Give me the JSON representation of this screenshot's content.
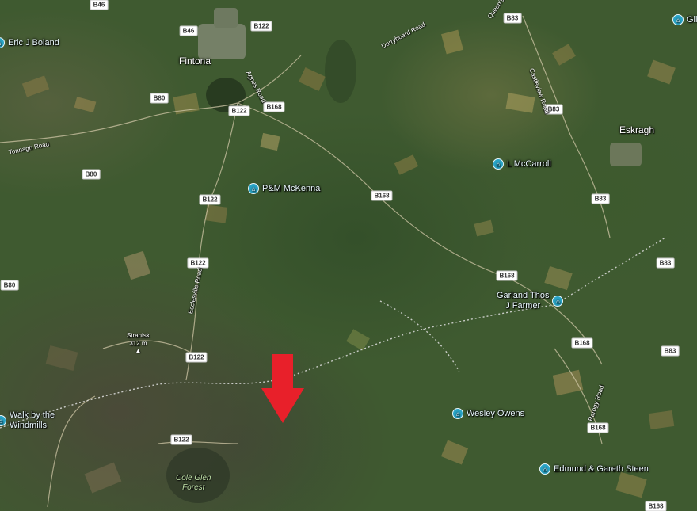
{
  "map": {
    "type": "satellite"
  },
  "road_labels": [
    "B46",
    "B46",
    "B122",
    "B83",
    "B80",
    "B122",
    "B168",
    "B83",
    "B80",
    "B168",
    "B122",
    "B122",
    "B168",
    "B80",
    "B83",
    "B83",
    "B122",
    "B168",
    "B83",
    "B122",
    "B168",
    "B168"
  ],
  "places": {
    "fintona": "Fintona",
    "eskragh": "Eskragh"
  },
  "street_names": {
    "ardsroad": "Agnes Road",
    "derryboard": "Derryboard Road",
    "tonnagh": "Tonnagh Road",
    "ecclesville": "Ecclesville Road",
    "road_right": "Castleview Road",
    "road_lower": "Rarogy Road",
    "road_top": "Queen's Road"
  },
  "pois": {
    "eric_j_boland": "Eric J Boland",
    "gil": "Gil",
    "l_mccarroll": "L McCarroll",
    "pm_mckenna": "P&M McKenna",
    "garland_line1": "Garland Thos",
    "garland_line2": "J Farmer",
    "wesley_owens": "Wesley Owens",
    "edmund_gareth": "Edmund & Gareth Steen",
    "walk_line1": "Walk by the",
    "walk_line2": "Windmills"
  },
  "peak": {
    "name": "Stranisk",
    "elevation": "312 m"
  },
  "forest": {
    "line1": "Cole Glen",
    "line2": "Forest"
  },
  "marker": {
    "color": "#e8202a",
    "shape": "arrow-down"
  },
  "colors": {
    "poi_pin": "#2aa5c7",
    "route_dots": "#e0e0e0"
  }
}
